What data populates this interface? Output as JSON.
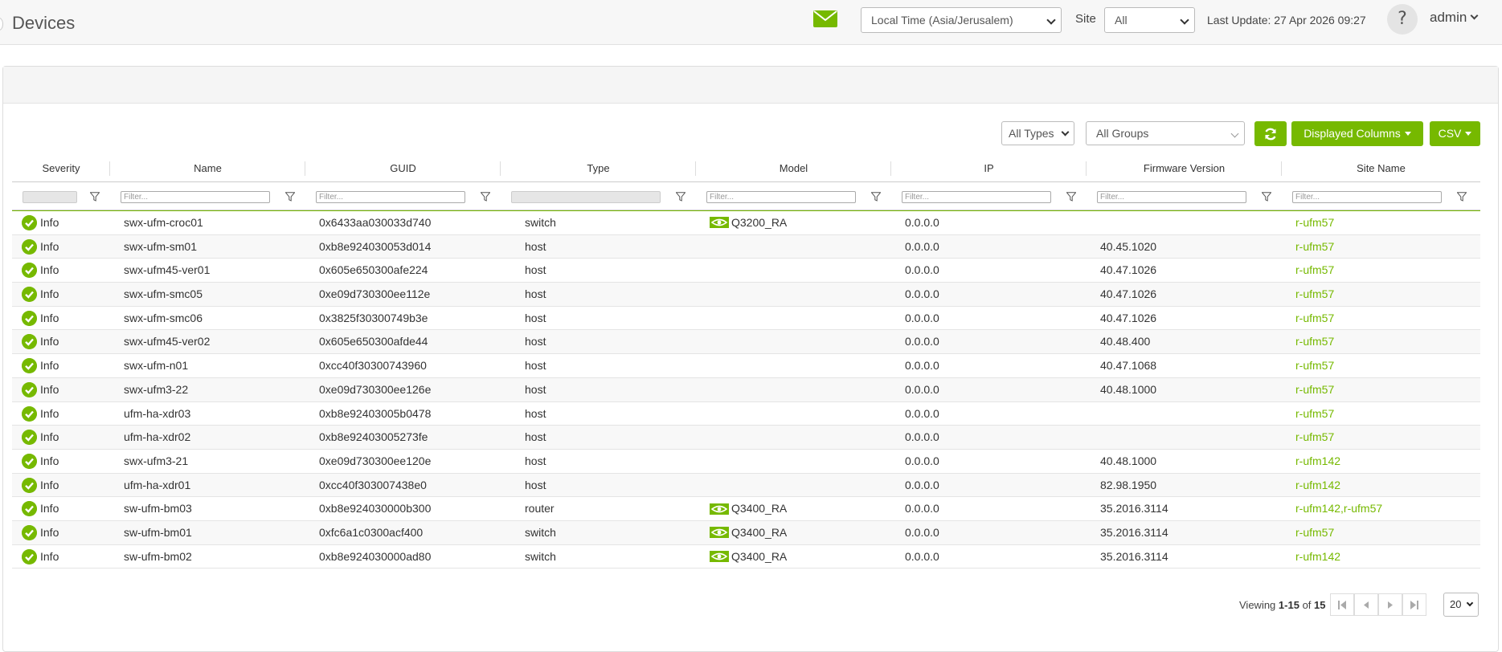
{
  "header": {
    "title": "Devices",
    "timezone_select": "Local Time (Asia/Jerusalem)",
    "site_label": "Site",
    "site_select": "All",
    "last_update": "Last Update: 27 Apr 2026 09:27",
    "help_label": "?",
    "user": "admin"
  },
  "toolbar": {
    "types_select": "All Types",
    "groups_select": "All Groups",
    "columns_button": "Displayed Columns",
    "csv_button": "CSV"
  },
  "columns": [
    "Severity",
    "Name",
    "GUID",
    "Type",
    "Model",
    "IP",
    "Firmware Version",
    "Site Name"
  ],
  "filter_placeholder": "Filter...",
  "rows": [
    {
      "severity": "Info",
      "name": "swx-ufm-croc01",
      "guid": "0x6433aa030033d740",
      "type": "switch",
      "model": "Q3200_RA",
      "ip": "0.0.0.0",
      "firmware": "",
      "site": "r-ufm57"
    },
    {
      "severity": "Info",
      "name": "swx-ufm-sm01",
      "guid": "0xb8e924030053d014",
      "type": "host",
      "model": "",
      "ip": "0.0.0.0",
      "firmware": "40.45.1020",
      "site": "r-ufm57"
    },
    {
      "severity": "Info",
      "name": "swx-ufm45-ver01",
      "guid": "0x605e650300afe224",
      "type": "host",
      "model": "",
      "ip": "0.0.0.0",
      "firmware": "40.47.1026",
      "site": "r-ufm57"
    },
    {
      "severity": "Info",
      "name": "swx-ufm-smc05",
      "guid": "0xe09d730300ee112e",
      "type": "host",
      "model": "",
      "ip": "0.0.0.0",
      "firmware": "40.47.1026",
      "site": "r-ufm57"
    },
    {
      "severity": "Info",
      "name": "swx-ufm-smc06",
      "guid": "0x3825f30300749b3e",
      "type": "host",
      "model": "",
      "ip": "0.0.0.0",
      "firmware": "40.47.1026",
      "site": "r-ufm57"
    },
    {
      "severity": "Info",
      "name": "swx-ufm45-ver02",
      "guid": "0x605e650300afde44",
      "type": "host",
      "model": "",
      "ip": "0.0.0.0",
      "firmware": "40.48.400",
      "site": "r-ufm57"
    },
    {
      "severity": "Info",
      "name": "swx-ufm-n01",
      "guid": "0xcc40f30300743960",
      "type": "host",
      "model": "",
      "ip": "0.0.0.0",
      "firmware": "40.47.1068",
      "site": "r-ufm57"
    },
    {
      "severity": "Info",
      "name": "swx-ufm3-22",
      "guid": "0xe09d730300ee126e",
      "type": "host",
      "model": "",
      "ip": "0.0.0.0",
      "firmware": "40.48.1000",
      "site": "r-ufm57"
    },
    {
      "severity": "Info",
      "name": "ufm-ha-xdr03",
      "guid": "0xb8e92403005b0478",
      "type": "host",
      "model": "",
      "ip": "0.0.0.0",
      "firmware": "",
      "site": "r-ufm57"
    },
    {
      "severity": "Info",
      "name": "ufm-ha-xdr02",
      "guid": "0xb8e92403005273fe",
      "type": "host",
      "model": "",
      "ip": "0.0.0.0",
      "firmware": "",
      "site": "r-ufm57"
    },
    {
      "severity": "Info",
      "name": "swx-ufm3-21",
      "guid": "0xe09d730300ee120e",
      "type": "host",
      "model": "",
      "ip": "0.0.0.0",
      "firmware": "40.48.1000",
      "site": "r-ufm142"
    },
    {
      "severity": "Info",
      "name": "ufm-ha-xdr01",
      "guid": "0xcc40f303007438e0",
      "type": "host",
      "model": "",
      "ip": "0.0.0.0",
      "firmware": "82.98.1950",
      "site": "r-ufm142"
    },
    {
      "severity": "Info",
      "name": "sw-ufm-bm03",
      "guid": "0xb8e924030000b300",
      "type": "router",
      "model": "Q3400_RA",
      "ip": "0.0.0.0",
      "firmware": "35.2016.3114",
      "site": "r-ufm142,r-ufm57"
    },
    {
      "severity": "Info",
      "name": "sw-ufm-bm01",
      "guid": "0xfc6a1c0300acf400",
      "type": "switch",
      "model": "Q3400_RA",
      "ip": "0.0.0.0",
      "firmware": "35.2016.3114",
      "site": "r-ufm57"
    },
    {
      "severity": "Info",
      "name": "sw-ufm-bm02",
      "guid": "0xb8e924030000ad80",
      "type": "switch",
      "model": "Q3400_RA",
      "ip": "0.0.0.0",
      "firmware": "35.2016.3114",
      "site": "r-ufm142"
    }
  ],
  "pager": {
    "viewing_prefix": "Viewing",
    "range": "1-15",
    "of": "of",
    "total": "15",
    "page_size": "20"
  },
  "colors": {
    "accent": "#76b900",
    "text": "#333333"
  },
  "icons": [
    "mail-icon",
    "refresh-icon",
    "check-circle-icon",
    "filter-icon",
    "nvidia-logo-icon",
    "first-page-icon",
    "prev-page-icon",
    "next-page-icon",
    "last-page-icon"
  ]
}
